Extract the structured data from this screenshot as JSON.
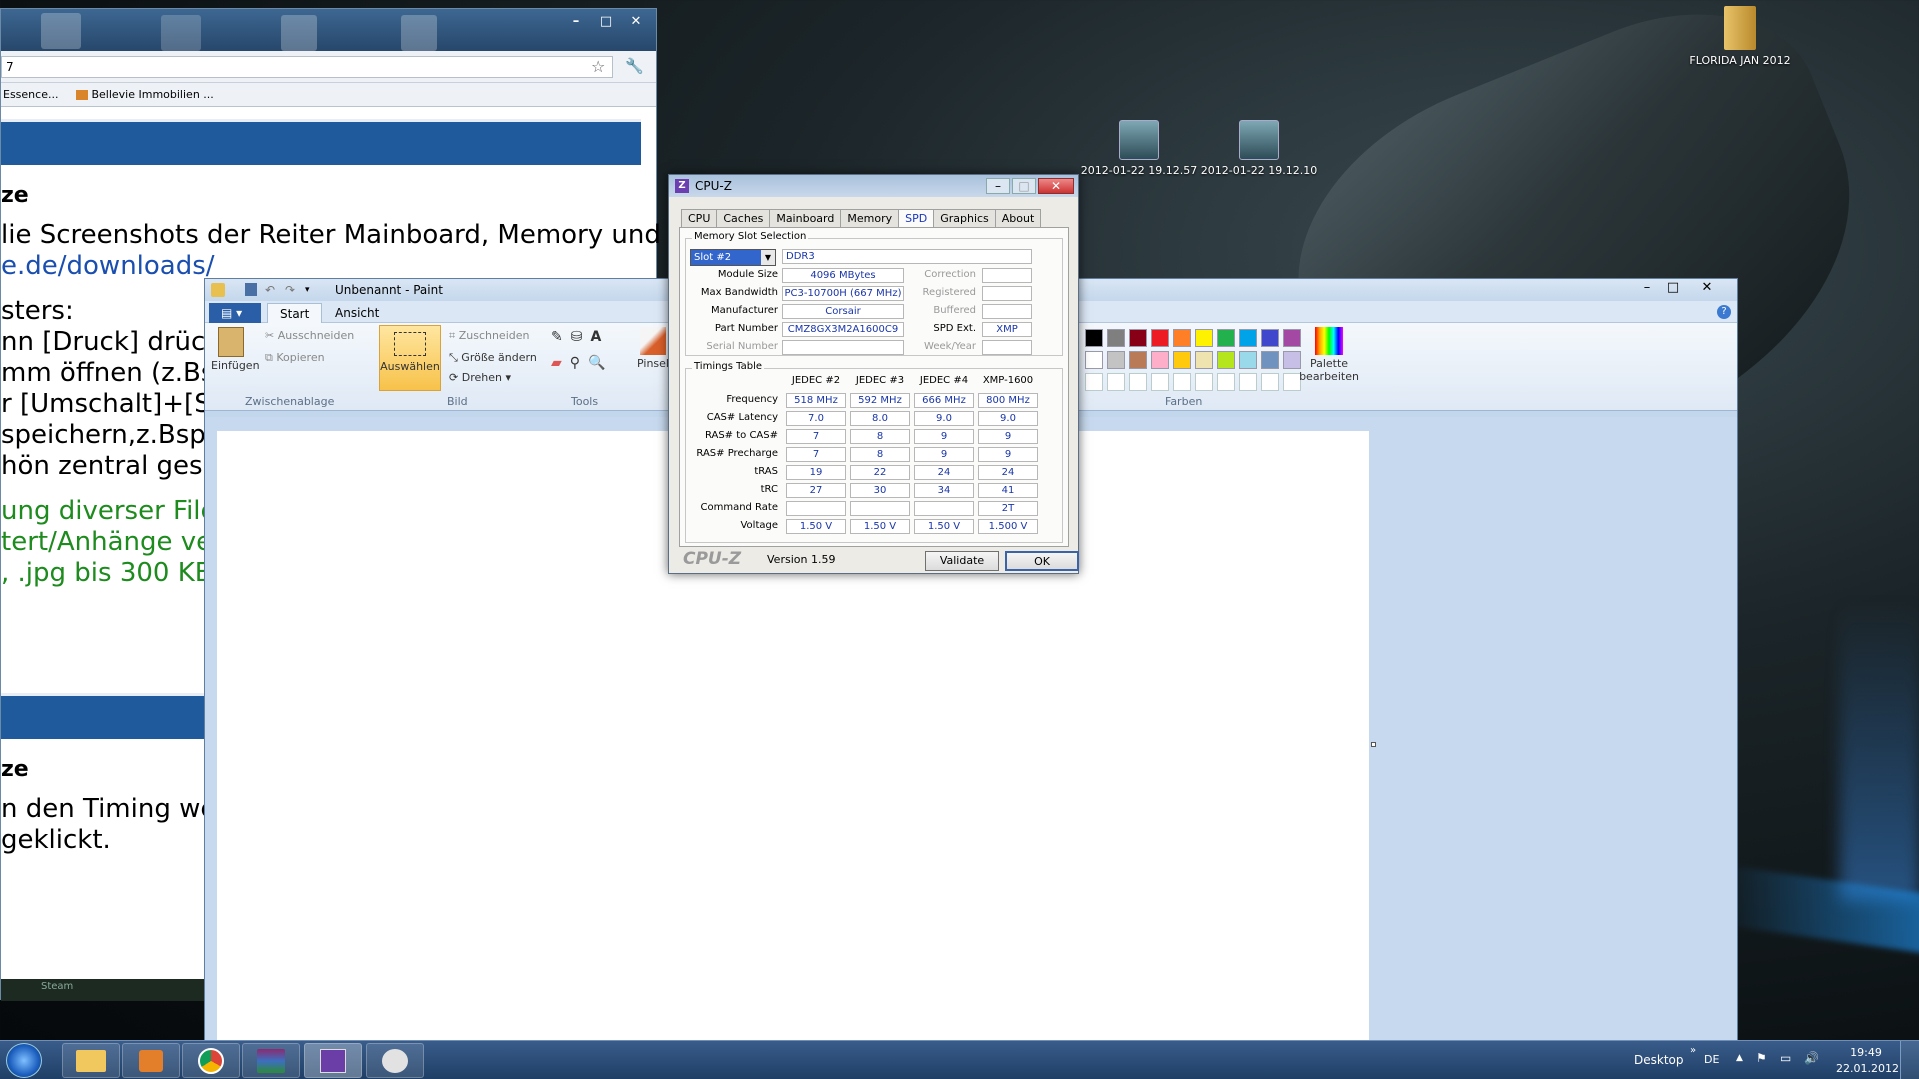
{
  "desktop": {
    "icons": [
      {
        "label": "FLORIDA JAN 2012",
        "icon": "folder-icon"
      },
      {
        "label": "2012-01-22 19.12.57",
        "icon": "image-file-icon"
      },
      {
        "label": "2012-01-22 19.12.10",
        "icon": "image-file-icon"
      }
    ]
  },
  "browser": {
    "address": "7",
    "bookmarks": [
      "Essence...",
      "Bellevie Immobilien ..."
    ],
    "content": {
      "heading1": "ze",
      "line1": "lie Screenshots der Reiter Mainboard, Memory und",
      "line2": "e.de/downloads/",
      "line3": "sters:",
      "line4": "nn [Druck] drüc",
      "line5": "mm öffnen (z.Bs",
      "line6": "r [Umschalt]+[S",
      "line7": "speichern,z.Bsp.",
      "line8": "hön zentral gesp",
      "green1": "ung diverser File",
      "green2": "tert/Anhänge ve",
      "green3": ", .jpg bis 300 KE",
      "heading2": "ze",
      "line9": "n den Timing we",
      "line10": "geklickt.",
      "status": "Steam"
    }
  },
  "paint": {
    "title": "Unbenannt - Paint",
    "tabs": [
      "Start",
      "Ansicht"
    ],
    "clipboard": {
      "paste": "Einfügen",
      "cut": "Ausschneiden",
      "copy": "Kopieren",
      "group": "Zwischenablage"
    },
    "image": {
      "select": "Auswählen",
      "crop": "Zuschneiden",
      "resize": "Größe ändern",
      "rotate": "Drehen",
      "group": "Bild"
    },
    "tools_group": "Tools",
    "brush": "Pinsel",
    "colors_group": "Farben",
    "edit_palette": "Palette bearbeiten",
    "palette_row1": [
      "#000000",
      "#7f7f7f",
      "#880015",
      "#ed1c24",
      "#ff7f27",
      "#fff200",
      "#22b14c",
      "#00a2e8",
      "#3f48cc",
      "#a349a4"
    ],
    "palette_row2": [
      "#ffffff",
      "#c3c3c3",
      "#b97a57",
      "#ffaec9",
      "#ffc90e",
      "#efe4b0",
      "#b5e61d",
      "#99d9ea",
      "#7092be",
      "#c8bfe7"
    ]
  },
  "cpuz": {
    "title": "CPU-Z",
    "tabs": [
      "CPU",
      "Caches",
      "Mainboard",
      "Memory",
      "SPD",
      "Graphics",
      "About"
    ],
    "active_tab": "SPD",
    "slot_section": "Memory Slot Selection",
    "slot": "Slot #2",
    "type": "DDR3",
    "labels": {
      "module_size": "Module Size",
      "max_bandwidth": "Max Bandwidth",
      "manufacturer": "Manufacturer",
      "part_number": "Part Number",
      "serial_number": "Serial Number",
      "correction": "Correction",
      "registered": "Registered",
      "buffered": "Buffered",
      "spd_ext": "SPD Ext.",
      "week_year": "Week/Year"
    },
    "values": {
      "module_size": "4096 MBytes",
      "max_bandwidth": "PC3-10700H (667 MHz)",
      "manufacturer": "Corsair",
      "part_number": "CMZ8GX3M2A1600C9",
      "spd_ext": "XMP"
    },
    "timings_section": "Timings Table",
    "columns": [
      "JEDEC #2",
      "JEDEC #3",
      "JEDEC #4",
      "XMP-1600"
    ],
    "rows": [
      {
        "label": "Frequency",
        "values": [
          "518 MHz",
          "592 MHz",
          "666 MHz",
          "800 MHz"
        ]
      },
      {
        "label": "CAS# Latency",
        "values": [
          "7.0",
          "8.0",
          "9.0",
          "9.0"
        ]
      },
      {
        "label": "RAS# to CAS#",
        "values": [
          "7",
          "8",
          "9",
          "9"
        ]
      },
      {
        "label": "RAS# Precharge",
        "values": [
          "7",
          "8",
          "9",
          "9"
        ]
      },
      {
        "label": "tRAS",
        "values": [
          "19",
          "22",
          "24",
          "24"
        ]
      },
      {
        "label": "tRC",
        "values": [
          "27",
          "30",
          "34",
          "41"
        ]
      },
      {
        "label": "Command Rate",
        "values": [
          "",
          "",
          "",
          "2T"
        ]
      },
      {
        "label": "Voltage",
        "values": [
          "1.50 V",
          "1.50 V",
          "1.50 V",
          "1.500 V"
        ]
      }
    ],
    "brand": "CPU-Z",
    "version": "Version 1.59",
    "validate": "Validate",
    "ok": "OK"
  },
  "taskbar": {
    "desktop_label": "Desktop",
    "language": "DE",
    "time": "19:49",
    "date": "22.01.2012",
    "apps": [
      "windows-explorer-icon",
      "media-player-icon",
      "chrome-icon",
      "winrar-icon",
      "cpuz-icon",
      "paint-icon"
    ]
  }
}
